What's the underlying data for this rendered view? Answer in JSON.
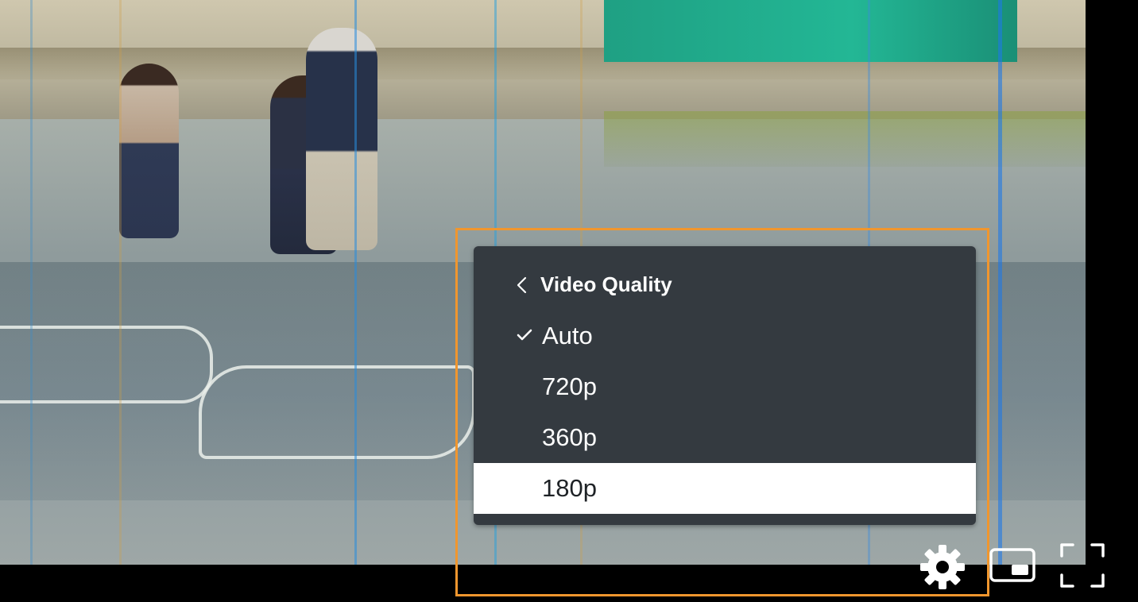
{
  "quality_menu": {
    "title": "Video Quality",
    "back_icon": "chevron-left-icon",
    "check_icon": "checkmark-icon",
    "options": [
      {
        "label": "Auto",
        "checked": true,
        "highlighted": false
      },
      {
        "label": "720p",
        "checked": false,
        "highlighted": false
      },
      {
        "label": "360p",
        "checked": false,
        "highlighted": false
      },
      {
        "label": "180p",
        "checked": false,
        "highlighted": true
      }
    ]
  },
  "controls": {
    "settings_icon": "gear-icon",
    "pip_icon": "picture-in-picture-icon",
    "fullscreen_icon": "fullscreen-icon"
  },
  "colors": {
    "menu_background": "#343a40",
    "menu_text": "#ffffff",
    "highlight_row": "#ffffff",
    "focus_outline": "#f0962e",
    "control_bar": "#000000"
  }
}
